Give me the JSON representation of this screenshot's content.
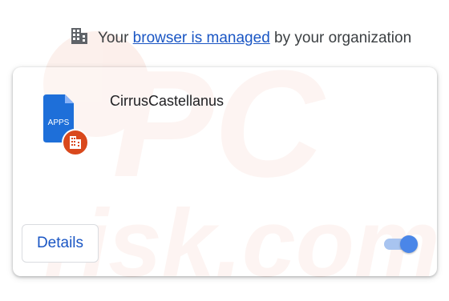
{
  "notice": {
    "prefix": "Your",
    "link": "browser is managed",
    "suffix": "by your organization",
    "icon": "building-icon"
  },
  "extension": {
    "name": "CirrusCastellanus",
    "icon_label": "APPS",
    "icon": "apps-file-icon",
    "badge_icon": "enterprise-building-icon"
  },
  "actions": {
    "details_label": "Details",
    "toggle_on": true
  },
  "watermark": {
    "text": "PC risk.com"
  },
  "colors": {
    "accent": "#1a56c4",
    "icon_blue": "#1e6fd9",
    "badge": "#d9481c",
    "toggle_knob": "#4a86e8",
    "toggle_track": "#a8c4f0"
  }
}
